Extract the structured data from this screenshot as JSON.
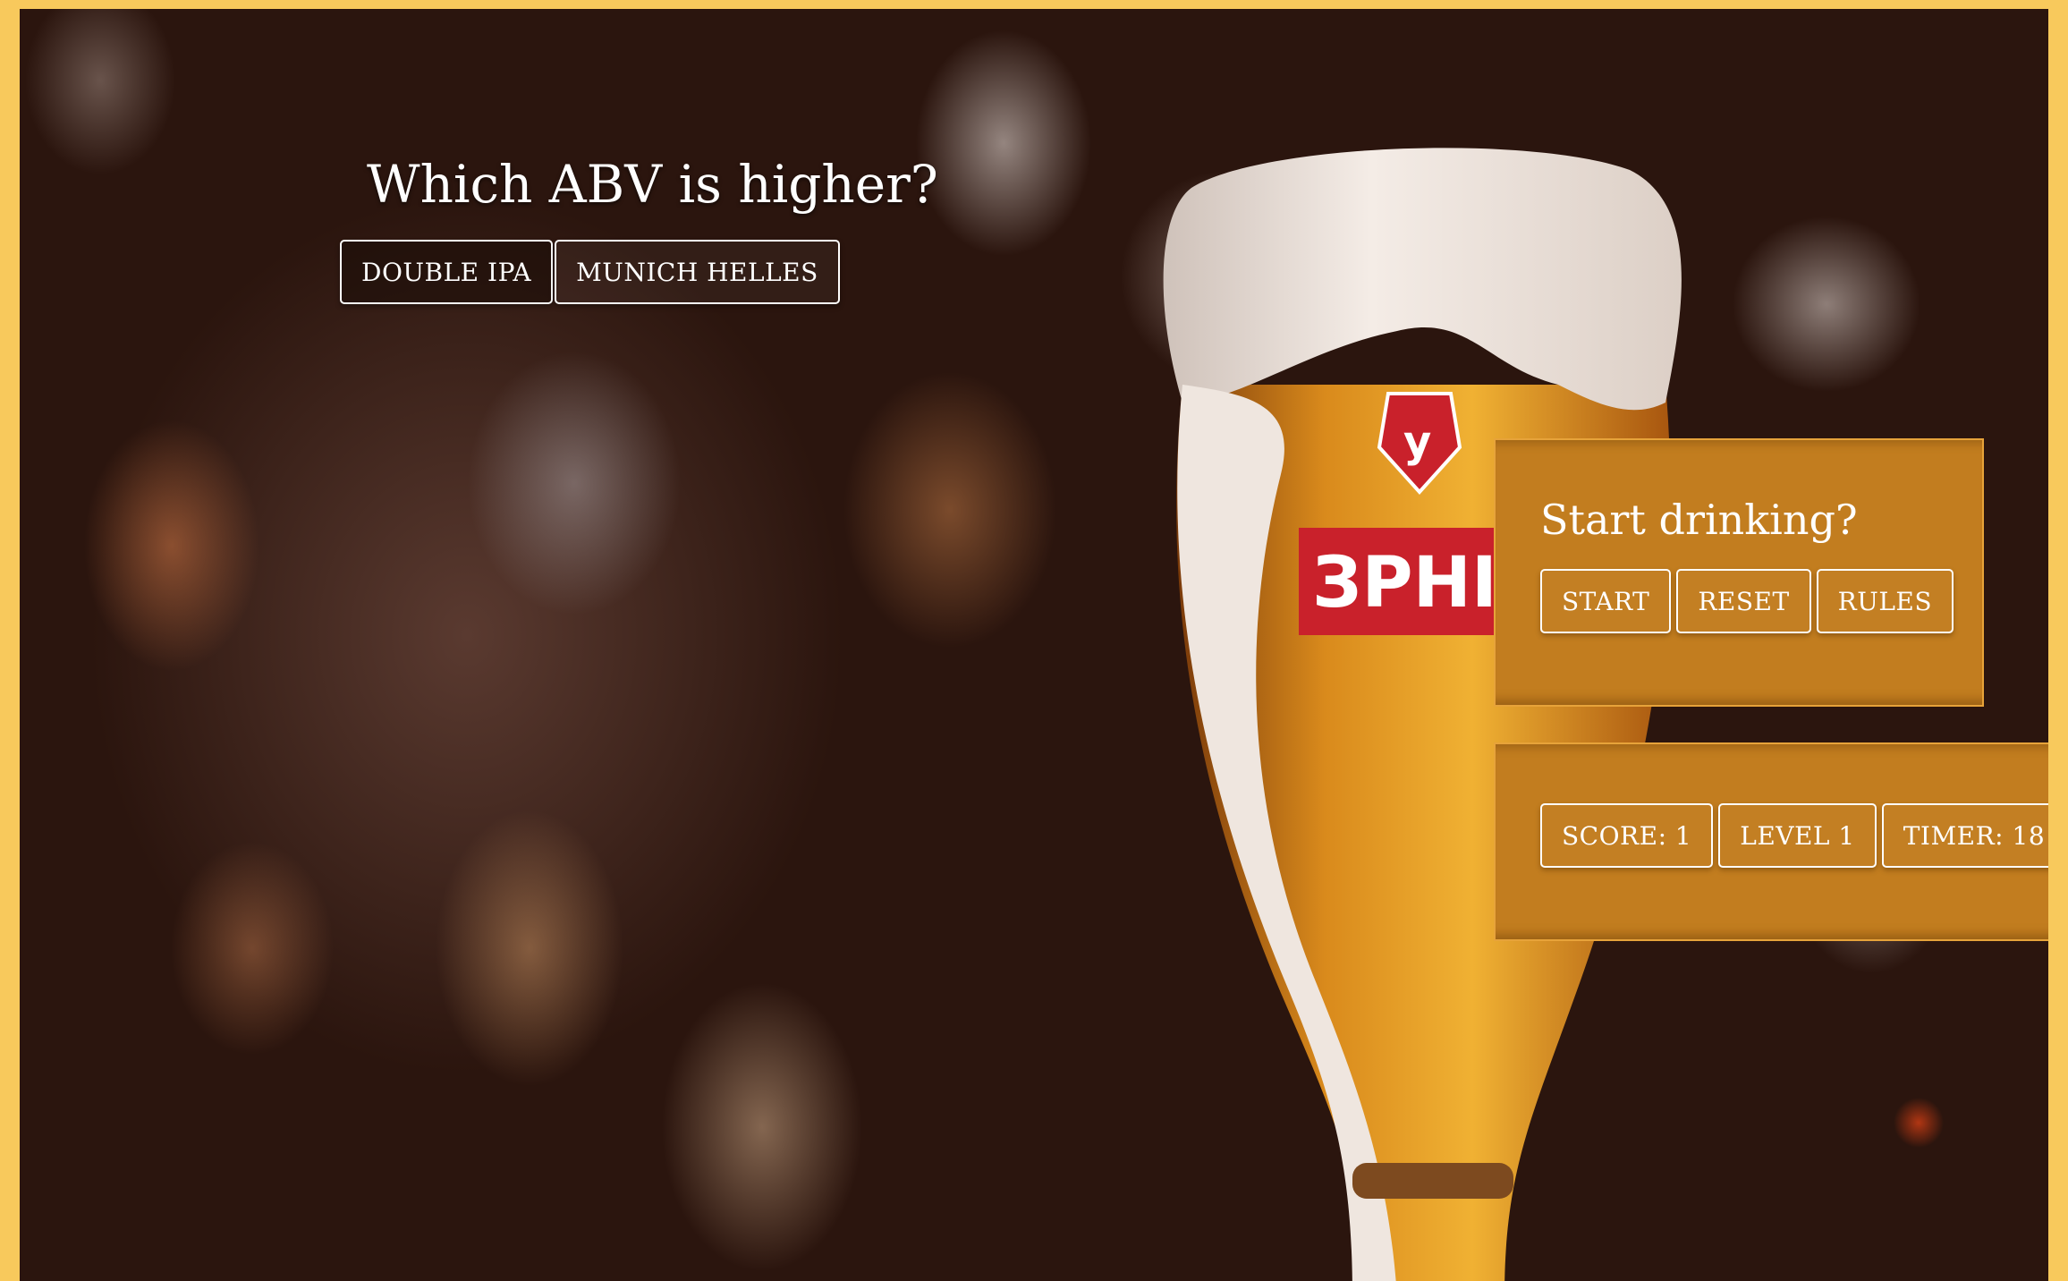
{
  "game": {
    "question": "Which ABV is higher?",
    "choices": [
      {
        "label": "Double IPA"
      },
      {
        "label": "Munich Helles"
      }
    ]
  },
  "start_panel": {
    "title": "Start drinking?",
    "buttons": {
      "start": "Start",
      "reset": "Reset",
      "rules": "Rules"
    }
  },
  "status_panel": {
    "score": "Score: 1",
    "level": "Level 1",
    "timer": "Timer: 18"
  },
  "background": {
    "glass_label": "ЗPHIrIBC"
  },
  "colors": {
    "frame": "#f8c95c",
    "panel": "#c27d1f",
    "panel_border": "#e7a33a",
    "text": "#ffffff"
  }
}
